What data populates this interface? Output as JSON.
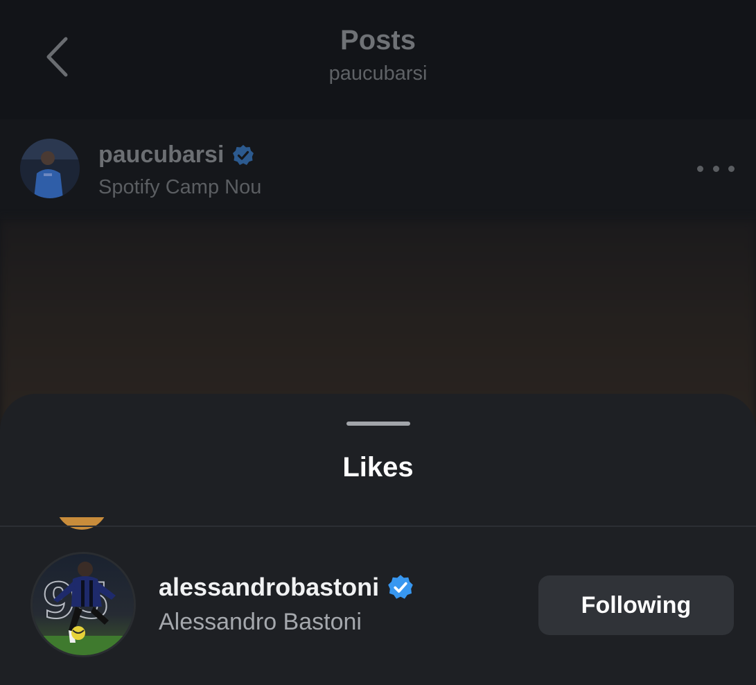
{
  "header": {
    "title": "Posts",
    "subtitle": "paucubarsi"
  },
  "post": {
    "username": "paucubarsi",
    "location": "Spotify Camp Nou",
    "verified": true,
    "avatar_icon": "user-avatar-photo",
    "more_icon": "more-horizontal-icon"
  },
  "likes_sheet": {
    "title": "Likes",
    "users": [
      {
        "username": "alessandrobastoni",
        "full_name": "Alessandro Bastoni",
        "verified": true,
        "avatar_icon": "user-avatar-photo",
        "jersey_number": "95",
        "button_label": "Following"
      }
    ]
  },
  "colors": {
    "verified_badge": "#3897f0",
    "sheet_background": "#1e2024",
    "button_background": "#303338",
    "dim_text": "#6c6f73"
  }
}
